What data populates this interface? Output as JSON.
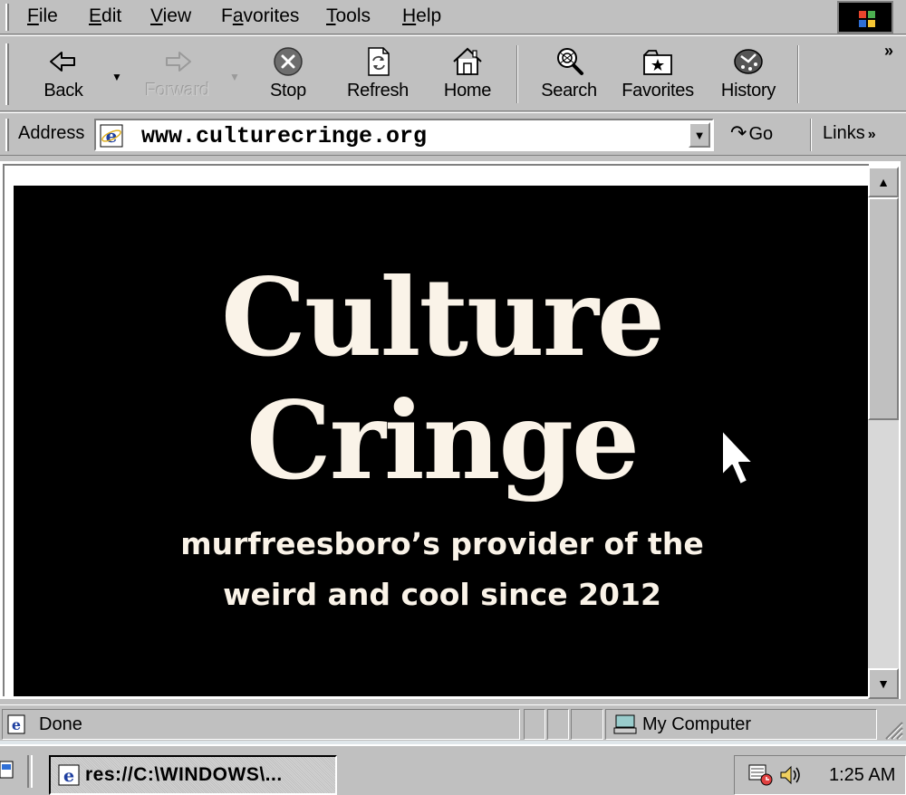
{
  "menu": {
    "items": [
      {
        "pre": "",
        "accel": "F",
        "post": "ile"
      },
      {
        "pre": "",
        "accel": "E",
        "post": "dit"
      },
      {
        "pre": "",
        "accel": "V",
        "post": "iew"
      },
      {
        "pre": "F",
        "accel": "a",
        "post": "vorites"
      },
      {
        "pre": "",
        "accel": "T",
        "post": "ools"
      },
      {
        "pre": "",
        "accel": "H",
        "post": "elp"
      }
    ]
  },
  "toolbar": {
    "back": "Back",
    "forward": "Forward",
    "stop": "Stop",
    "refresh": "Refresh",
    "home": "Home",
    "search": "Search",
    "favorites": "Favorites",
    "history": "History",
    "more": "»"
  },
  "address": {
    "label": "Address",
    "url": "www.culturecringe.org",
    "go": "Go",
    "links": "Links",
    "links_more": "»"
  },
  "page": {
    "title_line1": "Culture",
    "title_line2": "Cringe",
    "tagline_line1": "murfreesboro’s provider of the",
    "tagline_line2": "weird and cool since 2012"
  },
  "status": {
    "text": "Done",
    "zone": "My Computer"
  },
  "taskbar": {
    "window_label": "res://C:\\WINDOWS\\...",
    "clock": "1:25 AM"
  },
  "icons": {
    "back": "back-arrow-icon",
    "forward": "forward-arrow-icon",
    "stop": "stop-icon",
    "refresh": "refresh-icon",
    "home": "home-icon",
    "search": "search-icon",
    "favorites": "favorites-folder-icon",
    "history": "history-icon",
    "cursor": "mouse-pointer-icon"
  },
  "colors": {
    "chrome": "#c0c0c0",
    "hero_background": "#000000",
    "hero_text": "#faf3e8"
  }
}
